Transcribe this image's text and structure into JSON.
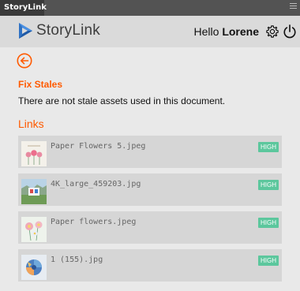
{
  "panel": {
    "tab_label": "StoryLink"
  },
  "header": {
    "brand": "StoryLink",
    "greeting": "Hello",
    "user": "Lorene"
  },
  "stales": {
    "title": "Fix Stales",
    "message": "There are not stale assets used in this document."
  },
  "links": {
    "title": "Links",
    "items": [
      {
        "filename": "Paper Flowers 5.jpeg",
        "badge": "HIGH"
      },
      {
        "filename": "4K_large_459203.jpg",
        "badge": "HIGH"
      },
      {
        "filename": "Paper flowers.jpeg",
        "badge": "HIGH"
      },
      {
        "filename": "1 (155).jpg",
        "badge": "HIGH"
      }
    ]
  },
  "colors": {
    "accent": "#ff5a00",
    "badge": "#5cc79d",
    "brand_blue": "#2f72c4"
  },
  "icons": {
    "logo": "storylink-play-logo",
    "back": "back-arrow-icon",
    "settings": "gear-icon",
    "power": "power-icon",
    "menu": "panel-menu-icon"
  }
}
